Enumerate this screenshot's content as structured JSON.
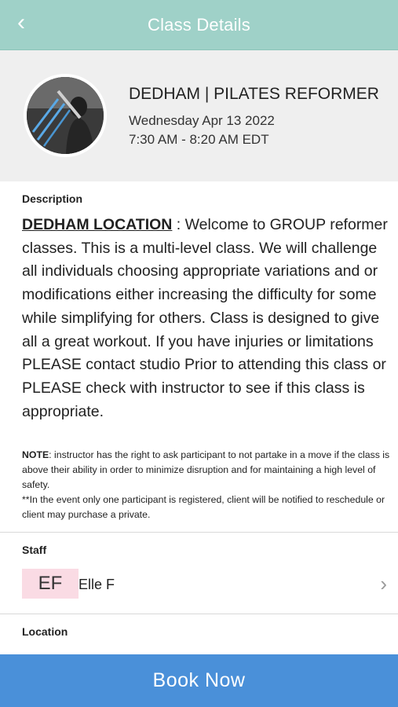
{
  "header": {
    "back_icon": "chevron-left-icon",
    "title": "Class Details"
  },
  "class_info": {
    "name": "DEDHAM | PILATES REFORMER",
    "date": "Wednesday Apr 13 2022",
    "time": "7:30 AM - 8:20 AM EDT"
  },
  "description": {
    "label": "Description",
    "location_heading": "DEDHAM LOCATION",
    "body": " : Welcome to GROUP reformer classes. This is a multi-level class. We will challenge all individuals choosing appropriate variations and or modifications either increasing the difficulty for some while simplifying for others. Class is designed to give all a great workout. If you have injuries or limitations PLEASE contact studio Prior to attending this class or PLEASE check with instructor to see if this class is appropriate.",
    "note_label": "NOTE",
    "note_text": ": instructor has the right to ask participant to not partake in a move if the class is above their ability in order to minimize disruption and for maintaining a high level of safety.",
    "note_extra": "**In the event only one participant is registered, client will be notified to reschedule or client may purchase a private."
  },
  "staff": {
    "label": "Staff",
    "initials": "EF",
    "name": "Elle F"
  },
  "location": {
    "label": "Location"
  },
  "book_button": {
    "label": "Book Now"
  },
  "colors": {
    "header_bg": "#9fd1c8",
    "book_button_bg": "#4a90d9",
    "initials_bg": "#fadbe4"
  }
}
